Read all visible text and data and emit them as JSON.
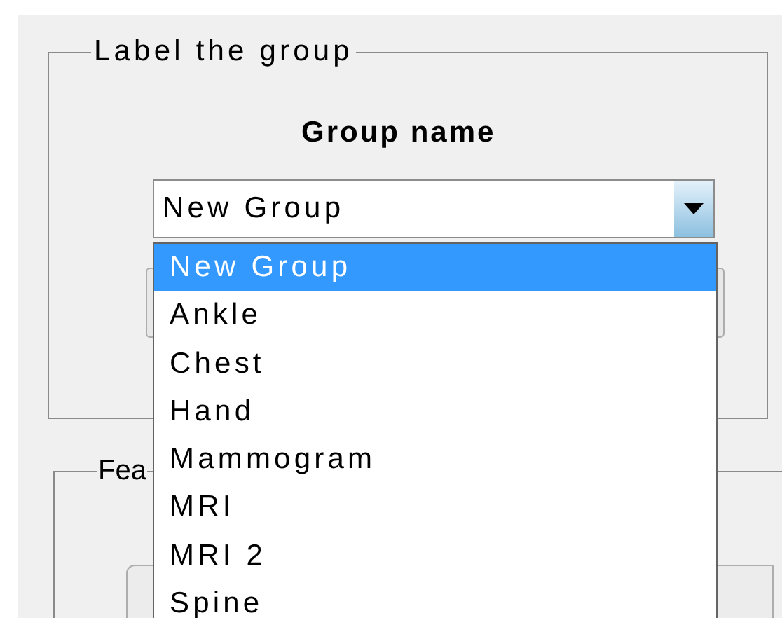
{
  "groups": [
    {
      "title": "Label the group",
      "field_label": "Group name",
      "combo": {
        "value": "New Group",
        "expanded": true,
        "options": [
          {
            "label": "New Group",
            "selected": true
          },
          {
            "label": "Ankle",
            "selected": false
          },
          {
            "label": "Chest",
            "selected": false
          },
          {
            "label": "Hand",
            "selected": false
          },
          {
            "label": "Mammogram",
            "selected": false
          },
          {
            "label": "MRI",
            "selected": false
          },
          {
            "label": "MRI 2",
            "selected": false
          },
          {
            "label": "Spine",
            "selected": false
          }
        ]
      }
    },
    {
      "title": "Fea"
    }
  ]
}
